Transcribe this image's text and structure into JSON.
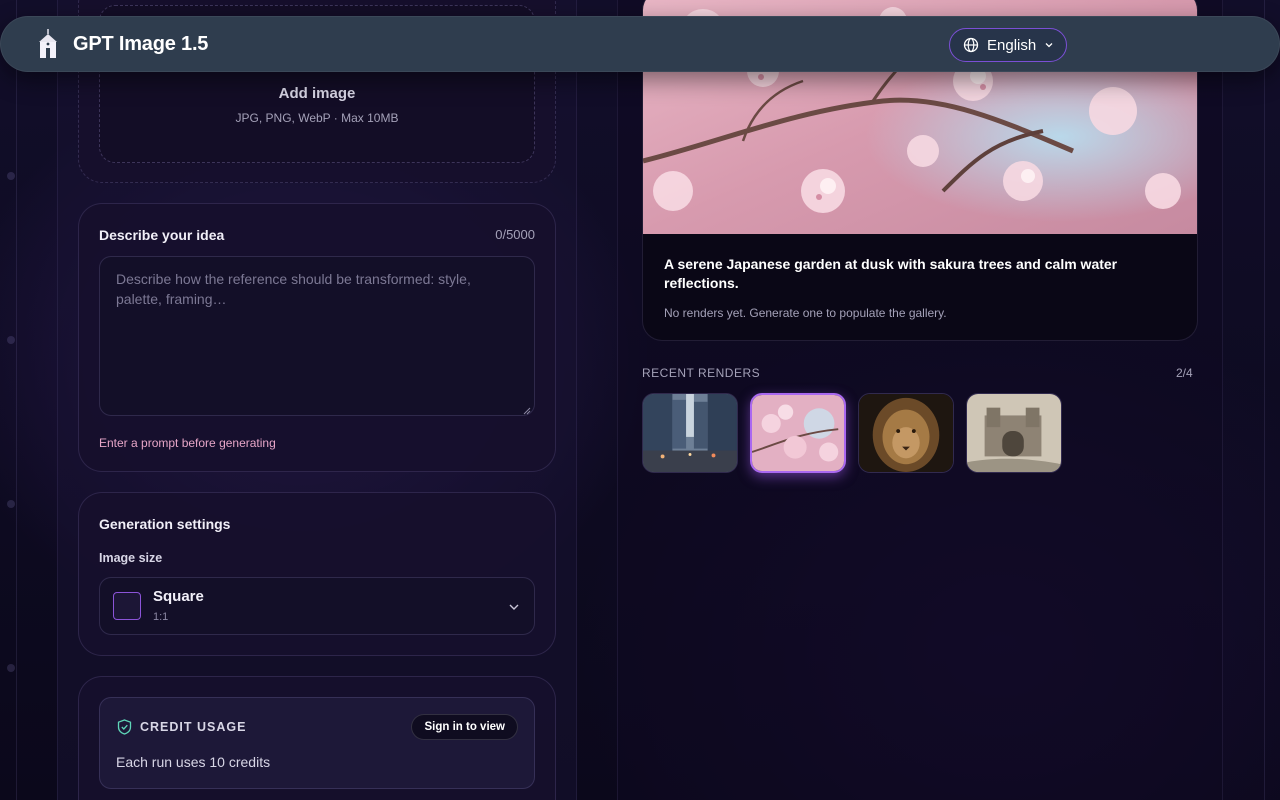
{
  "app": {
    "title": "GPT Image 1.5",
    "language": "English"
  },
  "upload": {
    "title": "Add image",
    "hint": "JPG, PNG, WebP · Max 10MB"
  },
  "idea": {
    "title": "Describe your idea",
    "counter": "0/5000",
    "prompt_value": "",
    "placeholder": "Describe how the reference should be transformed: style, palette, framing…",
    "error": "Enter a prompt before generating"
  },
  "settings": {
    "title": "Generation settings",
    "image_size_label": "Image size",
    "selected_size": "Square",
    "selected_ratio": "1:1"
  },
  "credits": {
    "title": "CREDIT USAGE",
    "signin_label": "Sign in to view",
    "note": "Each run uses 10 credits"
  },
  "preview": {
    "caption": "A serene Japanese garden at dusk with sakura trees and calm water reflections.",
    "empty_note": "No renders yet. Generate one to populate the gallery."
  },
  "recent": {
    "label": "RECENT RENDERS",
    "count": "2/4",
    "thumbs": [
      {
        "subject": "city-street"
      },
      {
        "subject": "cherry-blossom",
        "selected": true
      },
      {
        "subject": "lion"
      },
      {
        "subject": "castle-gate"
      }
    ]
  },
  "colors": {
    "accent": "#8b54d8",
    "error": "#e7a6c8",
    "header": "#2f3d4e"
  }
}
